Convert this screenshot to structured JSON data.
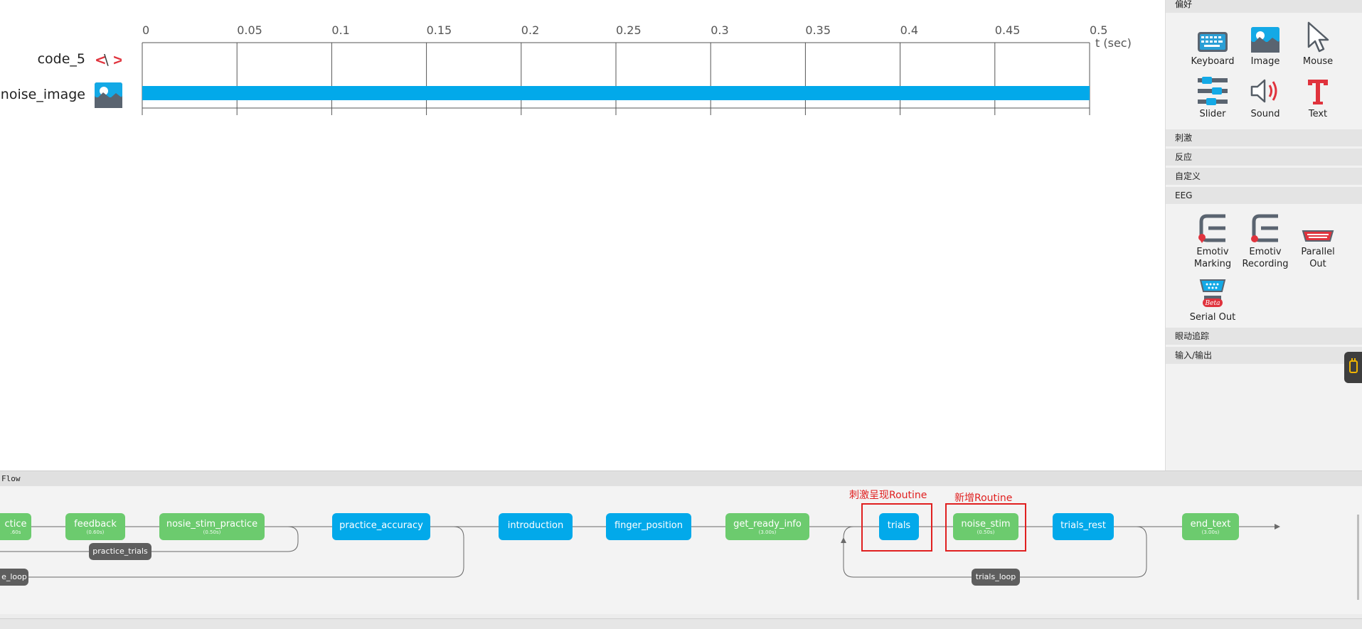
{
  "timeline": {
    "tick_labels": [
      "0",
      "0.05",
      "0.1",
      "0.15",
      "0.2",
      "0.25",
      "0.3",
      "0.35",
      "0.4",
      "0.45",
      "0.5"
    ],
    "axis_unit_label": "t (sec)",
    "components": [
      {
        "name": "code_5",
        "icon": "code-icon",
        "start": 0,
        "stop": 0
      },
      {
        "name": "noise_image",
        "icon": "image-icon",
        "start": 0,
        "stop": 0.5
      }
    ],
    "bar_color": "#02a9ea"
  },
  "panel": {
    "categories": {
      "favorites": "偏好",
      "stimuli": "刺激",
      "responses": "反应",
      "custom": "自定义",
      "eeg": "EEG",
      "eyetracking": "眼动追踪",
      "io": "输入/输出"
    },
    "favorites_items": [
      {
        "label": "Keyboard",
        "icon": "keyboard-icon"
      },
      {
        "label": "Image",
        "icon": "image-icon"
      },
      {
        "label": "Mouse",
        "icon": "mouse-pointer-icon"
      },
      {
        "label": "Slider",
        "icon": "slider-icon"
      },
      {
        "label": "Sound",
        "icon": "speaker-icon"
      },
      {
        "label": "Text",
        "icon": "text-icon"
      }
    ],
    "eeg_items": [
      {
        "label1": "Emotiv",
        "label2": "Marking",
        "icon": "emotiv-marking-icon"
      },
      {
        "label1": "Emotiv",
        "label2": "Recording",
        "icon": "emotiv-recording-icon"
      },
      {
        "label1": "Parallel",
        "label2": "Out",
        "icon": "parallel-port-icon"
      },
      {
        "label1": "Serial Out",
        "label2": "",
        "icon": "serial-port-icon",
        "badge": "Beta"
      }
    ]
  },
  "flow": {
    "title": "Flow",
    "routines": {
      "practice": {
        "label": "ctice",
        "dur": ".60s",
        "color": "green"
      },
      "feedback": {
        "label": "feedback",
        "dur": "(0.60s)",
        "color": "green"
      },
      "nosie_stim_practice": {
        "label": "nosie_stim_practice",
        "dur": "(0.50s)",
        "color": "green"
      },
      "practice_accuracy": {
        "label": "practice_accuracy",
        "dur": "",
        "color": "blue"
      },
      "introduction": {
        "label": "introduction",
        "dur": "",
        "color": "blue"
      },
      "finger_position": {
        "label": "finger_position",
        "dur": "",
        "color": "blue"
      },
      "get_ready_info": {
        "label": "get_ready_info",
        "dur": "(3.00s)",
        "color": "green"
      },
      "trials": {
        "label": "trials",
        "dur": "",
        "color": "blue"
      },
      "noise_stim": {
        "label": "noise_stim",
        "dur": "(0.50s)",
        "color": "green"
      },
      "trials_rest": {
        "label": "trials_rest",
        "dur": "",
        "color": "blue"
      },
      "end_text": {
        "label": "end_text",
        "dur": "(3.00s)",
        "color": "green"
      }
    },
    "loops": {
      "practice_trials": "practice_trials",
      "practice_loop": "e_loop",
      "trials_loop": "trials_loop"
    },
    "annotations": {
      "stim_routine": "刺激呈现Routine",
      "new_routine": "新增Routine"
    }
  }
}
